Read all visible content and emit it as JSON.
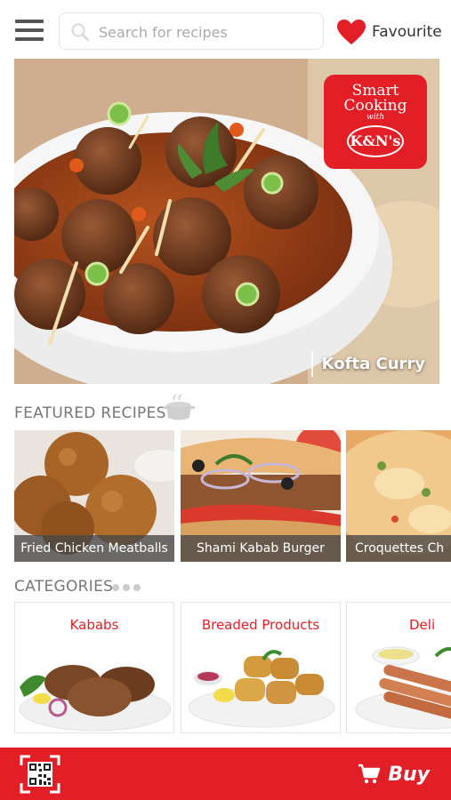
{
  "header": {
    "search_placeholder": "Search for recipes",
    "favourite_label": "Favourite"
  },
  "hero": {
    "caption": "Kofta Curry",
    "brand": {
      "line1": "Smart",
      "line2": "Cooking",
      "with": "with",
      "logo": "K&N's"
    }
  },
  "featured": {
    "title": "FEATURED RECIPES",
    "icon": "cooking-pot-icon",
    "items": [
      {
        "label": "Fried Chicken Meatballs"
      },
      {
        "label": "Shami Kabab Burger"
      },
      {
        "label": "Croquettes Ch"
      }
    ]
  },
  "categories": {
    "title": "CATEGORIES",
    "items": [
      {
        "label": "Kababs"
      },
      {
        "label": "Breaded Products"
      },
      {
        "label": "Deli"
      }
    ]
  },
  "bottom_bar": {
    "buy_label": "Buy",
    "qr_icon": "qr-scan-icon",
    "cart_icon": "cart-icon"
  },
  "colors": {
    "brand_red": "#e21f26",
    "text_gray": "#777777"
  }
}
